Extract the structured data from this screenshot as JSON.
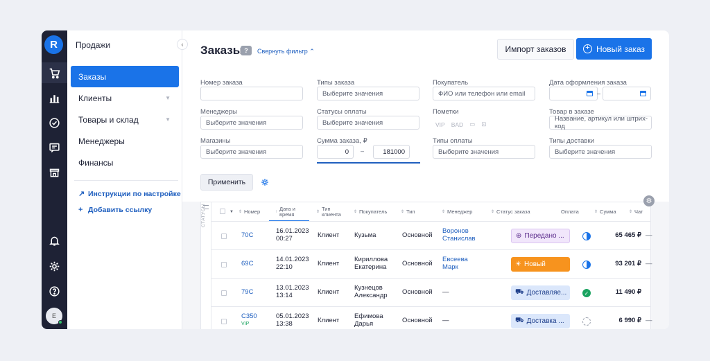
{
  "sidebar": {
    "section_title": "Продажи",
    "items": [
      {
        "label": "Заказы",
        "active": true
      },
      {
        "label": "Клиенты",
        "caret": true
      },
      {
        "label": "Товары и склад",
        "caret": true
      },
      {
        "label": "Менеджеры"
      },
      {
        "label": "Финансы"
      }
    ],
    "links": [
      {
        "icon": "arrow-up-right-icon",
        "label": "Инструкции по настройке"
      },
      {
        "icon": "plus-icon",
        "label": "Добавить ссылку"
      }
    ],
    "avatar_initial": "E"
  },
  "rail_icons": [
    "cart-icon",
    "chart-icon",
    "check-circle-icon",
    "chat-icon",
    "store-icon",
    "bell-icon",
    "gear-icon",
    "help-icon"
  ],
  "header": {
    "title": "Заказы",
    "filter_toggle": "Свернуть фильтр",
    "import_button": "Импорт заказов",
    "new_button": "Новый заказ"
  },
  "filters": {
    "order_number": {
      "label": "Номер заказа",
      "value": ""
    },
    "order_types": {
      "label": "Типы заказа",
      "placeholder": "Выберите значения"
    },
    "customer": {
      "label": "Покупатель",
      "placeholder": "ФИО или телефон или email"
    },
    "order_date": {
      "label": "Дата оформления заказа",
      "separator": "–"
    },
    "managers": {
      "label": "Менеджеры",
      "placeholder": "Выберите значения"
    },
    "payment_statuses": {
      "label": "Статусы оплаты",
      "placeholder": "Выберите значения"
    },
    "marks": {
      "label": "Пометки",
      "items": [
        "VIP",
        "BAD"
      ]
    },
    "product": {
      "label": "Товар в заказе",
      "placeholder": "Название, артикул или штрих-код"
    },
    "stores": {
      "label": "Магазины",
      "placeholder": "Выберите значения"
    },
    "sum": {
      "label": "Сумма заказа, ₽",
      "min": "0",
      "max": "181000",
      "separator": "–"
    },
    "payment_types": {
      "label": "Типы оплаты",
      "placeholder": "Выберите значения"
    },
    "delivery_types": {
      "label": "Типы доставки",
      "placeholder": "Выберите значения"
    },
    "apply_button": "Применить"
  },
  "table": {
    "side_label": "СТАТУСЫ",
    "columns": {
      "number": "Номер",
      "date": "Дата и время",
      "client_type": "Тип клиента",
      "customer": "Покупатель",
      "type": "Тип",
      "manager": "Менеджер",
      "status": "Статус заказа",
      "payment": "Оплата",
      "sum": "Сумма",
      "chat": "Чат"
    },
    "rows": [
      {
        "number": "70C",
        "vip": "",
        "date": "16.01.2023",
        "time": "00:27",
        "client_type": "Клиент",
        "customer1": "Кузьма",
        "customer2": "",
        "type": "Основной",
        "manager1": "Воронов",
        "manager2": "Станислав",
        "status": "Передано ...",
        "status_style": "purple",
        "payment": "half",
        "sum": "65 465 ₽",
        "chat": "—"
      },
      {
        "number": "69C",
        "vip": "",
        "date": "14.01.2023",
        "time": "22:10",
        "client_type": "Клиент",
        "customer1": "Кириллова",
        "customer2": "Екатерина",
        "type": "Основной",
        "manager1": "Евсеева",
        "manager2": "Марк",
        "status": "Новый",
        "status_style": "orange",
        "payment": "half",
        "sum": "93 201 ₽",
        "chat": "—"
      },
      {
        "number": "79C",
        "vip": "",
        "date": "13.01.2023",
        "time": "13:14",
        "client_type": "Клиент",
        "customer1": "Кузнецов",
        "customer2": "Александр",
        "type": "Основной",
        "manager1": "—",
        "manager2": "",
        "status": "Доставляе...",
        "status_style": "blue",
        "payment": "ok",
        "sum": "11 490 ₽",
        "chat": ""
      },
      {
        "number": "C350",
        "vip": "VIP",
        "date": "05.01.2023",
        "time": "13:38",
        "client_type": "Клиент",
        "customer1": "Ефимова",
        "customer2": "Дарья",
        "type": "Основной",
        "manager1": "—",
        "manager2": "",
        "status": "Доставка ...",
        "status_style": "blue",
        "payment": "wait",
        "sum": "6 990 ₽",
        "chat": "—"
      }
    ]
  }
}
